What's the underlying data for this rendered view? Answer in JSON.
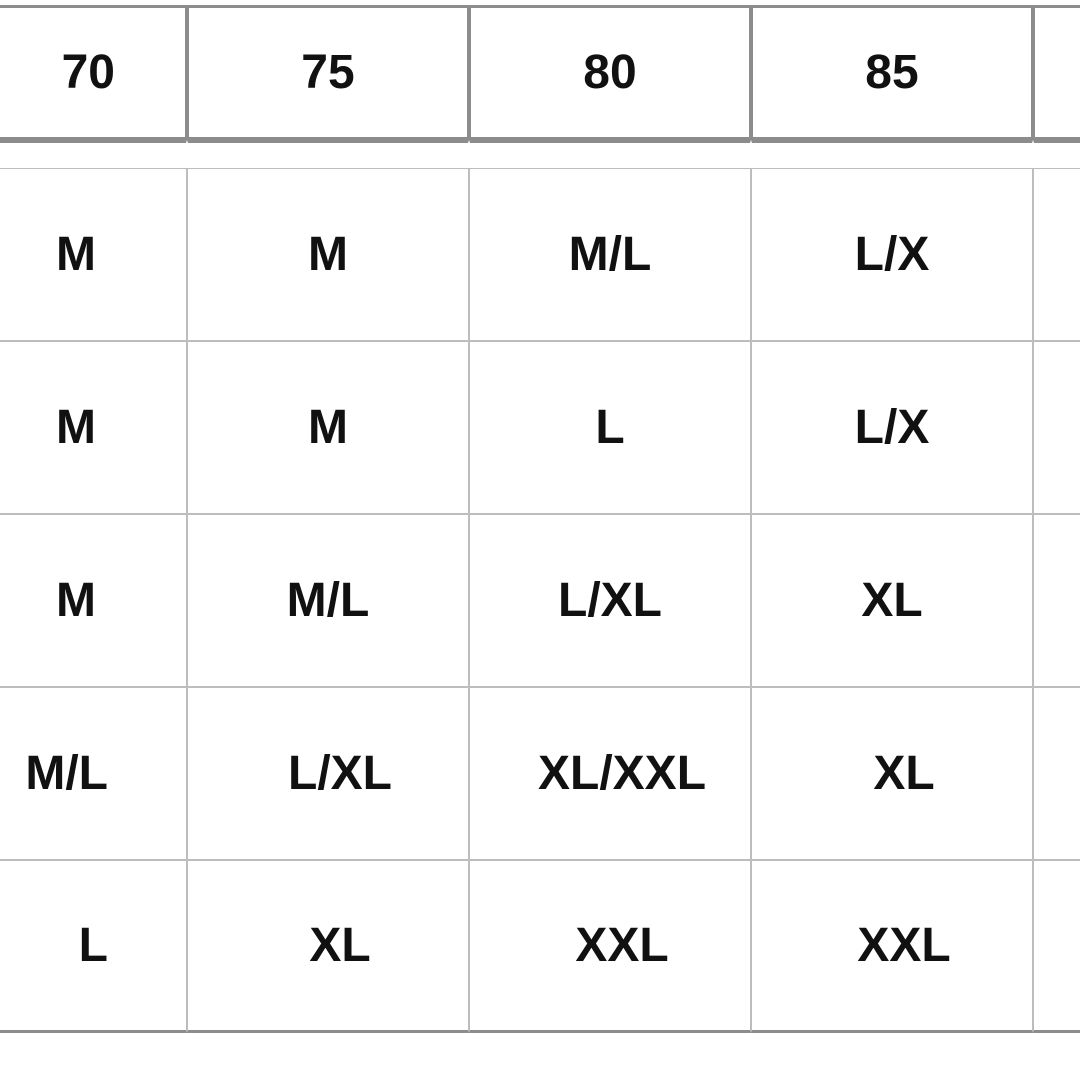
{
  "chart_data": {
    "type": "table",
    "title": "",
    "note": "Image is a cropped spreadsheet table. Leftmost column and rightmost column are partially cut off.",
    "columns": [
      "70",
      "75",
      "80",
      "85"
    ],
    "rows": [
      [
        "M",
        "M",
        "M/L",
        "L/X"
      ],
      [
        "M",
        "M",
        "L",
        "L/X"
      ],
      [
        "M",
        "M/L",
        "L/XL",
        "XL"
      ],
      [
        "M/L",
        "L/XL",
        "XL/XXL",
        "XL"
      ],
      [
        "L",
        "XL",
        "XXL",
        "XXL"
      ]
    ]
  },
  "table": {
    "headers": {
      "c0": "70",
      "c1": "75",
      "c2": "80",
      "c3": "85",
      "c4_partial": ""
    },
    "rows": [
      {
        "c0": "M",
        "c1": "M",
        "c2": "M/L",
        "c3": "L/X",
        "c4_partial": ""
      },
      {
        "c0": "M",
        "c1": "M",
        "c2": "L",
        "c3": "L/X",
        "c4_partial": ""
      },
      {
        "c0": "M",
        "c1": "M/L",
        "c2": "L/XL",
        "c3": "XL",
        "c4_partial": ""
      },
      {
        "c0": "M/L",
        "c1": "L/XL",
        "c2": "XL/XXL",
        "c3": "XL",
        "c4_partial": ""
      },
      {
        "c0": "L",
        "c1": "XL",
        "c2": "XXL",
        "c3": "XXL",
        "c4_partial": ""
      }
    ]
  }
}
